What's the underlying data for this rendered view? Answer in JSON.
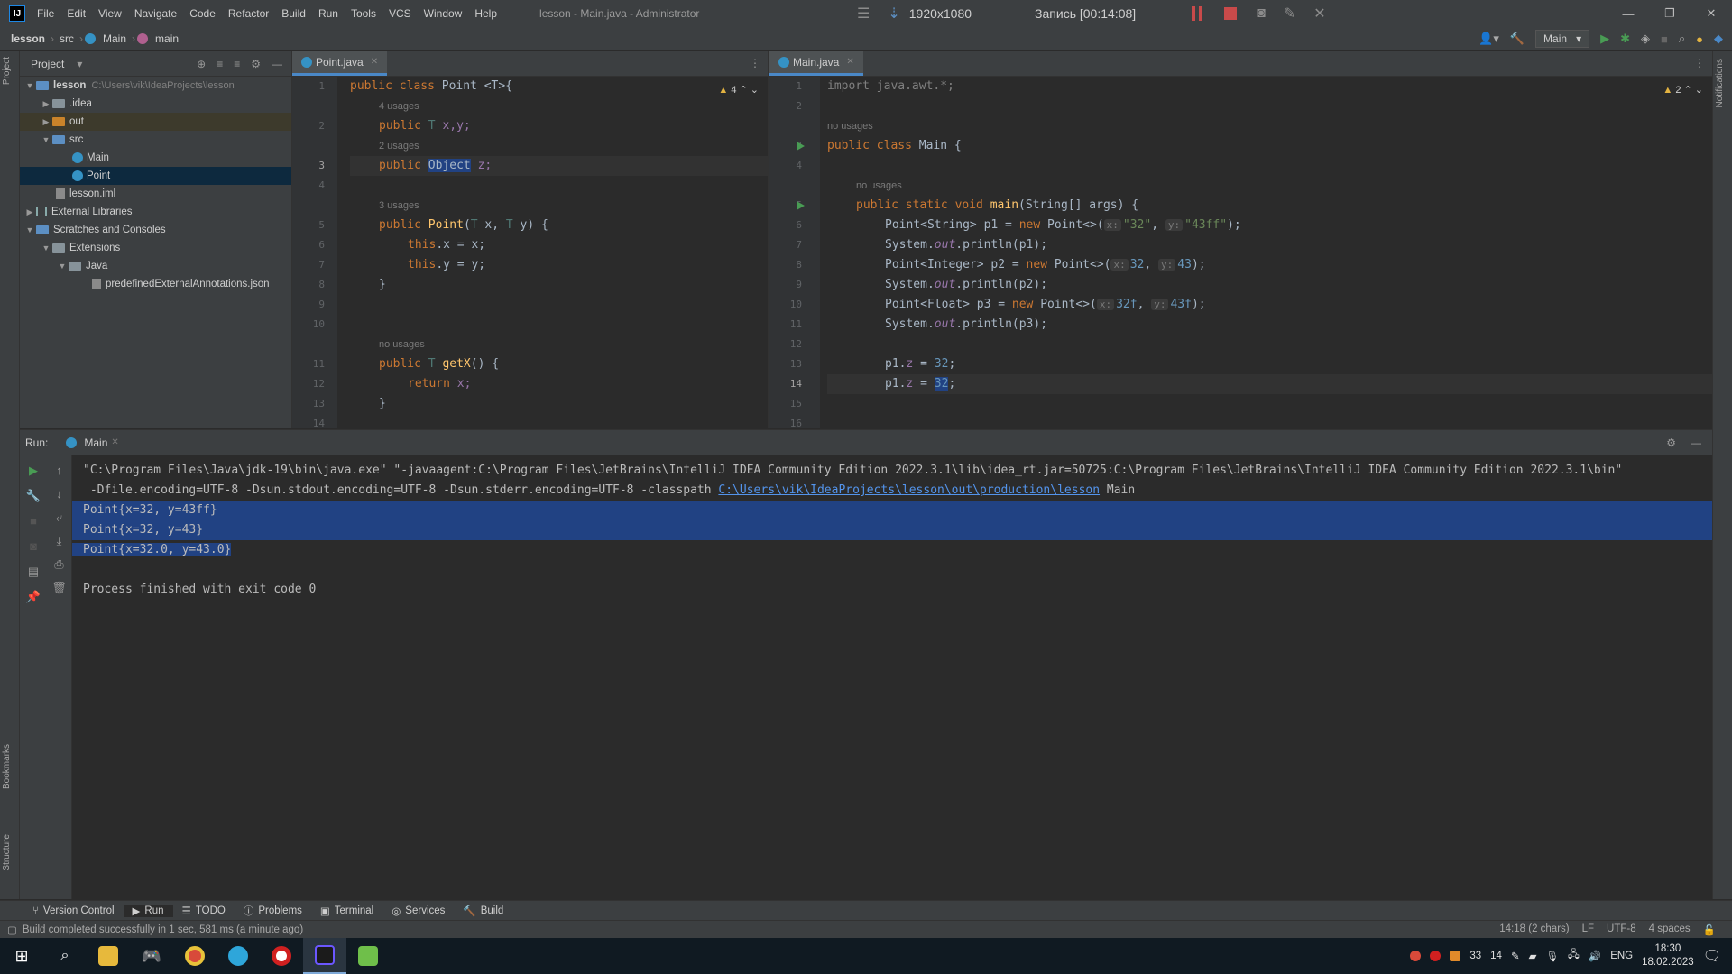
{
  "app": {
    "logo": "IJ",
    "window_title": "lesson - Main.java - Administrator"
  },
  "menu": [
    "File",
    "Edit",
    "View",
    "Navigate",
    "Code",
    "Refactor",
    "Build",
    "Run",
    "Tools",
    "VCS",
    "Window",
    "Help"
  ],
  "recorder": {
    "resolution": "1920x1080",
    "timer": "Запись [00:14:08]"
  },
  "breadcrumb": {
    "project": "lesson",
    "folder": "src",
    "class": "Main",
    "method": "main"
  },
  "toolbar": {
    "run_config": "Main"
  },
  "left_strip": {
    "project": "Project",
    "bookmarks": "Bookmarks",
    "structure": "Structure"
  },
  "right_strip": {
    "notifications": "Notifications"
  },
  "project_panel": {
    "title": "Project",
    "tree": [
      {
        "label": "lesson",
        "path": "C:\\Users\\vik\\IdeaProjects\\lesson"
      },
      {
        "label": ".idea"
      },
      {
        "label": "out"
      },
      {
        "label": "src"
      },
      {
        "label": "Main"
      },
      {
        "label": "Point"
      },
      {
        "label": "lesson.iml"
      },
      {
        "label": "External Libraries"
      },
      {
        "label": "Scratches and Consoles"
      },
      {
        "label": "Extensions"
      },
      {
        "label": "Java"
      },
      {
        "label": "predefinedExternalAnnotations.json"
      }
    ]
  },
  "editor_left": {
    "tab": "Point.java",
    "warnings": "4",
    "line_numbers": [
      "1",
      "",
      "2",
      "",
      "3",
      "4",
      "",
      "5",
      "6",
      "7",
      "8",
      "9",
      "10",
      "",
      "11",
      "12",
      "13",
      "14"
    ],
    "hints": {
      "h1": "4 usages",
      "h2": "2 usages",
      "h3": "3 usages",
      "h4": "no usages"
    },
    "code": {
      "l1a": "public class ",
      "l1b": "Point ",
      "l1c": "<T>{",
      "l2a": "public ",
      "l2b": "T",
      "l2c": " x,y;",
      "l3a": "public ",
      "l3b": "Object",
      "l3c": " z;",
      "l5a": "public ",
      "l5b": "Point",
      "l5c": "(",
      "l5d": "T",
      "l5e": " x, ",
      "l5f": "T",
      "l5g": " y) {",
      "l6a": "this",
      "l6b": ".x = x;",
      "l7a": "this",
      "l7b": ".y = y;",
      "l8": "}",
      "l11a": "public ",
      "l11b": "T",
      "l11c": " getX",
      "l11d": "() {",
      "l12a": "return ",
      "l12b": "x;",
      "l13": "}"
    }
  },
  "editor_right": {
    "tab": "Main.java",
    "warnings": "2",
    "line_numbers": [
      "1",
      "2",
      "",
      "3",
      "4",
      "",
      "5",
      "6",
      "7",
      "8",
      "9",
      "10",
      "11",
      "12",
      "13",
      "14",
      "15",
      "16"
    ],
    "hints": {
      "h1": "no usages",
      "h2": "no usages"
    },
    "code": {
      "l1": "import java.awt.*;",
      "l3a": "public class ",
      "l3b": "Main {",
      "l5a": "public static void ",
      "l5b": "main",
      "l5c": "(String[] args) {",
      "l6a": "Point<String> p1 = ",
      "l6b": "new ",
      "l6c": "Point<>(",
      "l6d": "x:",
      "l6e": "\"32\"",
      "l6f": ", ",
      "l6g": "y:",
      "l6h": "\"43ff\"",
      "l6i": ");",
      "l7a": "System.",
      "l7b": "out",
      "l7c": ".println(p1);",
      "l8a": "Point<Integer> p2 = ",
      "l8b": "new ",
      "l8c": "Point<>(",
      "l8d": "x:",
      "l8e": "32",
      "l8f": ", ",
      "l8g": "y:",
      "l8h": "43",
      "l8i": ");",
      "l9a": "System.",
      "l9b": "out",
      "l9c": ".println(p2);",
      "l10a": "Point<Float> p3 = ",
      "l10b": "new ",
      "l10c": "Point<>(",
      "l10d": "x:",
      "l10e": "32f",
      "l10f": ", ",
      "l10g": "y:",
      "l10h": "43f",
      "l10i": ");",
      "l11a": "System.",
      "l11b": "out",
      "l11c": ".println(p3);",
      "l13a": "p1.",
      "l13b": "z",
      "l13c": " = ",
      "l13d": "32",
      "l13e": ";",
      "l14a": "p1.",
      "l14b": "z",
      "l14c": " = ",
      "l14d": "32",
      "l14e": ";"
    }
  },
  "run_panel": {
    "label": "Run:",
    "tab": "Main",
    "console": {
      "cmd1": "\"C:\\Program Files\\Java\\jdk-19\\bin\\java.exe\" \"-javaagent:C:\\Program Files\\JetBrains\\IntelliJ IDEA Community Edition 2022.3.1\\lib\\idea_rt.jar=50725:C:\\Program Files\\JetBrains\\IntelliJ IDEA Community Edition 2022.3.1\\bin\"",
      "cmd2a": " -Dfile.encoding=UTF-8 -Dsun.stdout.encoding=UTF-8 -Dsun.stderr.encoding=UTF-8 -classpath ",
      "cmd2b": "C:\\Users\\vik\\IdeaProjects\\lesson\\out\\production\\lesson",
      "cmd2c": " Main",
      "out1": "Point{x=32, y=43ff}",
      "out2": "Point{x=32, y=43}",
      "out3": "Point{x=32.0, y=43.0}",
      "exit": "Process finished with exit code 0"
    }
  },
  "tool_windows": [
    "Version Control",
    "Run",
    "TODO",
    "Problems",
    "Terminal",
    "Services",
    "Build"
  ],
  "status": {
    "message": "Build completed successfully in 1 sec, 581 ms (a minute ago)",
    "position": "14:18 (2 chars)",
    "line_sep": "LF",
    "encoding": "UTF-8",
    "indent": "4 spaces"
  },
  "taskbar": {
    "tray_num1": "33",
    "tray_num2": "14",
    "lang": "ENG",
    "time": "18:30",
    "date": "18.02.2023"
  }
}
